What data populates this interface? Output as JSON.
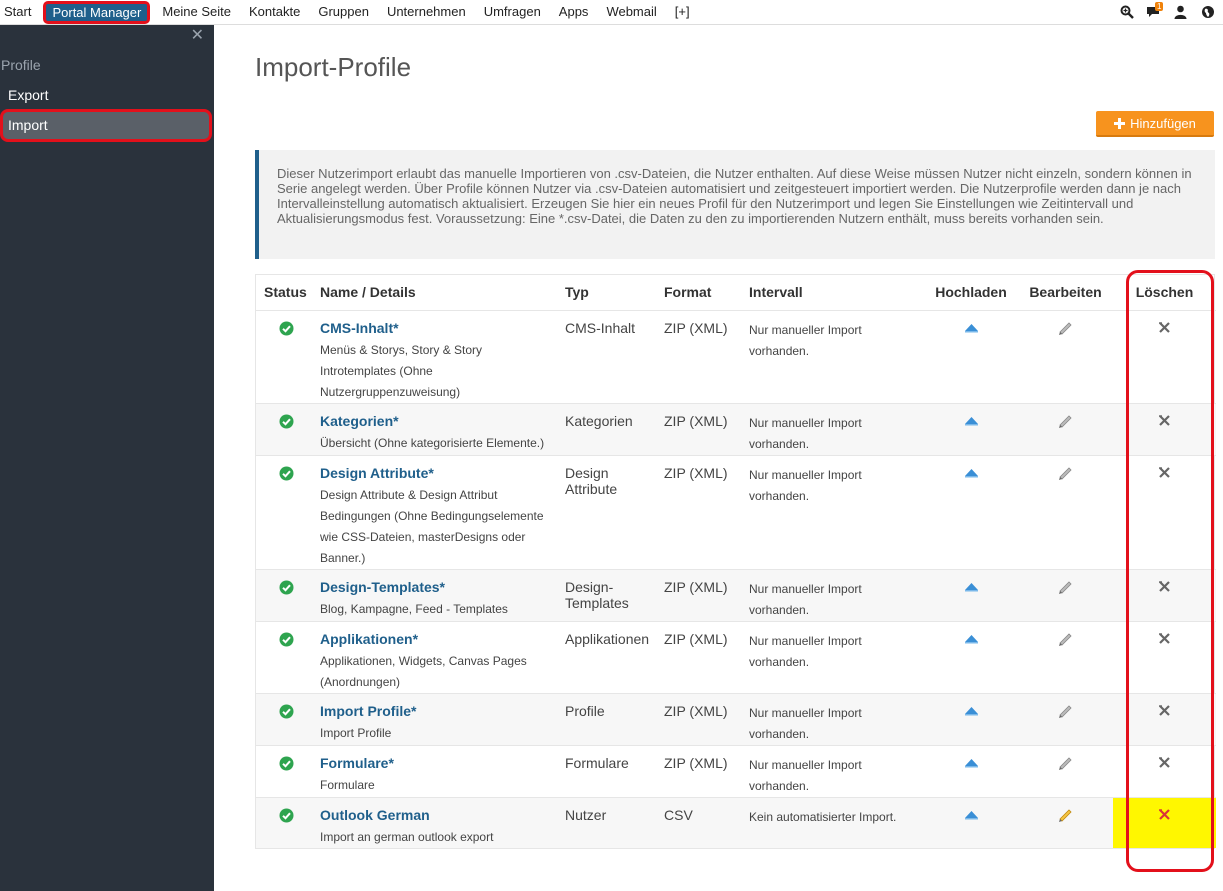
{
  "topnav": {
    "items": [
      "Start",
      "Portal Manager",
      "Meine Seite",
      "Kontakte",
      "Gruppen",
      "Unternehmen",
      "Umfragen",
      "Apps",
      "Webmail",
      "[+]"
    ],
    "active": "Portal Manager",
    "notification_count": "1"
  },
  "sidebar": {
    "section": "Profile",
    "items": [
      "Export",
      "Import"
    ],
    "active": "Import"
  },
  "main": {
    "title": "Import-Profile",
    "add_label": "Hinzufügen",
    "info": "Dieser Nutzerimport erlaubt das manuelle Importieren von .csv-Dateien, die Nutzer enthalten. Auf diese Weise müssen Nutzer nicht einzeln, sondern können in Serie angelegt werden. Über Profile können Nutzer via .csv-Dateien automatisiert und zeitgesteuert importiert werden. Die Nutzerprofile werden dann je nach Intervalleinstellung automatisch aktualisiert. Erzeugen Sie hier ein neues Profil für den Nutzerimport und legen Sie Einstellungen wie Zeitintervall und Aktualisierungsmodus fest. Voraussetzung: Eine *.csv-Datei, die Daten zu den zu importierenden Nutzern enthält, muss bereits vorhanden sein."
  },
  "table": {
    "headers": [
      "Status",
      "Name / Details",
      "Typ",
      "Format",
      "Intervall",
      "Hochladen",
      "Bearbeiten",
      "Löschen"
    ],
    "rows": [
      {
        "name": "CMS-Inhalt",
        "star": "*",
        "details": "Menüs & Storys, Story & Story Introtemplates (Ohne Nutzergruppenzuweisung)",
        "typ": "CMS-Inhalt",
        "format": "ZIP (XML)",
        "interval": "Nur manueller Import vorhanden."
      },
      {
        "name": "Kategorien",
        "star": "*",
        "details": "Übersicht (Ohne kategorisierte Elemente.)",
        "typ": "Kategorien",
        "format": "ZIP (XML)",
        "interval": "Nur manueller Import vorhanden."
      },
      {
        "name": "Design Attribute",
        "star": "*",
        "details": "Design Attribute & Design Attribut Bedingungen (Ohne Bedingungselemente wie CSS-Dateien, masterDesigns oder Banner.)",
        "typ": "Design Attribute",
        "format": "ZIP (XML)",
        "interval": "Nur manueller Import vorhanden."
      },
      {
        "name": "Design-Templates",
        "star": "*",
        "details": "Blog, Kampagne, Feed - Templates",
        "typ": "Design-Templates",
        "format": "ZIP (XML)",
        "interval": "Nur manueller Import vorhanden."
      },
      {
        "name": "Applikationen",
        "star": "*",
        "details": "Applikationen, Widgets, Canvas Pages (Anordnungen)",
        "typ": "Applikationen",
        "format": "ZIP (XML)",
        "interval": "Nur manueller Import vorhanden."
      },
      {
        "name": "Import Profile",
        "star": "*",
        "details": "Import Profile",
        "typ": "Profile",
        "format": "ZIP (XML)",
        "interval": "Nur manueller Import vorhanden."
      },
      {
        "name": "Formulare",
        "star": "*",
        "details": "Formulare",
        "typ": "Formulare",
        "format": "ZIP (XML)",
        "interval": "Nur manueller Import vorhanden."
      },
      {
        "name": "Outlook German",
        "star": "",
        "details": "Import an german outlook export",
        "typ": "Nutzer",
        "format": "CSV",
        "interval": "Kein automatisierter Import."
      }
    ]
  },
  "colors": {
    "accent": "#1f5f8b",
    "highlight_red": "#e3101b",
    "add_orange": "#f7931e",
    "ok_green": "#2ea44f",
    "upload_blue": "#3a8fd6",
    "row_highlight": "#fff700"
  }
}
